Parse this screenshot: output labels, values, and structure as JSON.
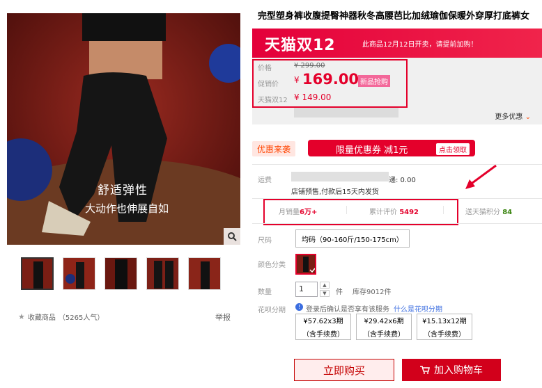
{
  "product": {
    "title": "完型塑身裤收腹提臀神器秋冬高腰芭比加绒瑜伽保暖外穿厚打底裤女"
  },
  "gallery": {
    "caption_main": "舒适弹性",
    "caption_sub": "大动作也伸展自如",
    "thumb_count": 5
  },
  "banner": {
    "logo": "天猫双12",
    "text": "此商品12月12日开卖，请提前加购！"
  },
  "price": {
    "original_label": "价格",
    "original_value": "¥ 299.00",
    "promo_label": "促销价",
    "currency": "¥",
    "promo_value": "169.00",
    "promo_badge": "新品抢购",
    "double12_label": "天猫双12",
    "double12_value": "¥ 149.00",
    "more": "更多优惠"
  },
  "promotion": {
    "tag": "优惠来袭",
    "coupon_text": "限量优惠券 减1元",
    "coupon_button": "点击领取"
  },
  "shipping": {
    "label": "运费",
    "fee_suffix": "递: 0.00",
    "note": "店铺预售,付款后15天内发货"
  },
  "stats": {
    "monthly_label": "月销量",
    "monthly_value": "6万+",
    "reviews_label": "累计评价",
    "reviews_value": "5492",
    "points_label": "送天猫积分",
    "points_value": "84"
  },
  "options": {
    "size_label": "尺码",
    "size_value": "均码（90-160斤/150-175cm）",
    "color_label": "颜色分类",
    "qty_label": "数量",
    "qty_value": "1",
    "qty_unit": "件",
    "stock": "库存9012件"
  },
  "installment": {
    "label": "花呗分期",
    "notice": "登录后确认是否享有该服务",
    "link": "什么是花呗分期",
    "plans": [
      {
        "price": "¥57.62x3期",
        "fee": "（含手续费）"
      },
      {
        "price": "¥29.42x6期",
        "fee": "（含手续费）"
      },
      {
        "price": "¥15.13x12期",
        "fee": "（含手续费）"
      }
    ]
  },
  "actions": {
    "buy": "立即购买",
    "cart": "加入购物车"
  },
  "favorites": {
    "label": "收藏商品",
    "count": "（5265人气）"
  },
  "report": "举报",
  "colors": {
    "tmall_red": "#e4002b",
    "price_red": "#e4002b",
    "points_green": "#36820b"
  }
}
